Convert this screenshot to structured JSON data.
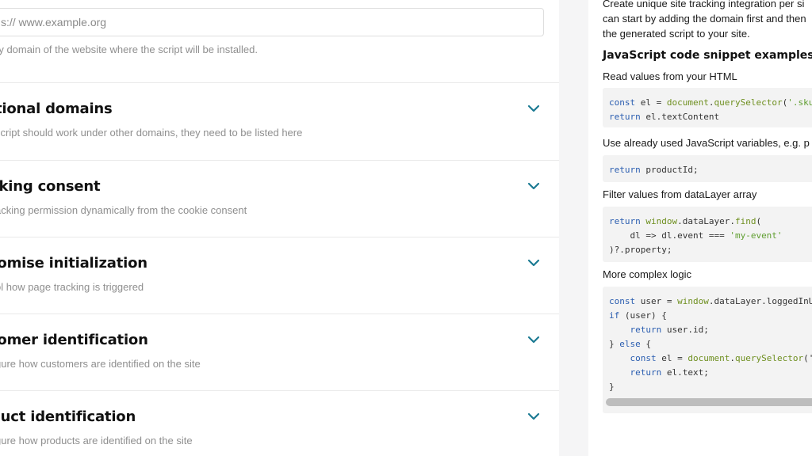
{
  "domain": {
    "placeholder": "s:// www.example.org",
    "hint": "ry domain of the website where the script will be installed."
  },
  "sections": [
    {
      "title": "itional domains",
      "desc": "script should work under other domains, they need to be listed here"
    },
    {
      "title": "cking consent",
      "desc": "acking permission dynamically from the cookie consent"
    },
    {
      "title": "tomise initialization",
      "desc": "ol how page tracking is triggered"
    },
    {
      "title": "tomer identification",
      "desc": "gure how customers are identified on the site"
    },
    {
      "title": "duct identification",
      "desc": "gure how products are identified on the site"
    }
  ],
  "sidebar": {
    "intro_lines": [
      "Create unique site tracking integration per si",
      "can start by adding the domain first and then",
      "the generated script to your site."
    ],
    "heading": "JavaScript code snippet examples",
    "examples": [
      {
        "title": "Read values from your HTML",
        "code": [
          [
            {
              "t": "const",
              "c": "kw"
            },
            {
              "t": " el = "
            },
            {
              "t": "document",
              "c": "fn"
            },
            {
              "t": "."
            },
            {
              "t": "querySelector",
              "c": "fn"
            },
            {
              "t": "("
            },
            {
              "t": "'.sku",
              "c": "str"
            }
          ],
          [
            {
              "t": "return",
              "c": "kw"
            },
            {
              "t": " el.textContent"
            }
          ]
        ]
      },
      {
        "title": "Use already used JavaScript variables, e.g. p",
        "code": [
          [
            {
              "t": "return",
              "c": "kw"
            },
            {
              "t": " productId;"
            }
          ]
        ]
      },
      {
        "title": "Filter values from dataLayer array",
        "code": [
          [
            {
              "t": "return",
              "c": "kw"
            },
            {
              "t": " "
            },
            {
              "t": "window",
              "c": "fn"
            },
            {
              "t": ".dataLayer."
            },
            {
              "t": "find",
              "c": "fn"
            },
            {
              "t": "("
            }
          ],
          [
            {
              "t": "    dl => dl.event === "
            },
            {
              "t": "'my-event'",
              "c": "str"
            }
          ],
          [
            {
              "t": ")?.property;"
            }
          ]
        ]
      },
      {
        "title": "More complex logic",
        "code": [
          [
            {
              "t": "const",
              "c": "kw"
            },
            {
              "t": " user = "
            },
            {
              "t": "window",
              "c": "fn"
            },
            {
              "t": ".dataLayer.loggedInU"
            }
          ],
          [
            {
              "t": "if",
              "c": "kw"
            },
            {
              "t": " (user) {"
            }
          ],
          [
            {
              "t": "    "
            },
            {
              "t": "return",
              "c": "kw"
            },
            {
              "t": " user.id;"
            }
          ],
          [
            {
              "t": "} "
            },
            {
              "t": "else",
              "c": "kw"
            },
            {
              "t": " {"
            }
          ],
          [
            {
              "t": "    "
            },
            {
              "t": "const",
              "c": "kw"
            },
            {
              "t": " el = "
            },
            {
              "t": "document",
              "c": "fn"
            },
            {
              "t": "."
            },
            {
              "t": "querySelector",
              "c": "fn"
            },
            {
              "t": "('"
            }
          ],
          [
            {
              "t": "    "
            },
            {
              "t": "return",
              "c": "kw"
            },
            {
              "t": " el.text;"
            }
          ],
          [
            {
              "t": "}"
            }
          ]
        ]
      }
    ]
  },
  "colors": {
    "accent": "#1b7a93"
  },
  "icons": {
    "section_toggle": "chevron-down-icon"
  }
}
